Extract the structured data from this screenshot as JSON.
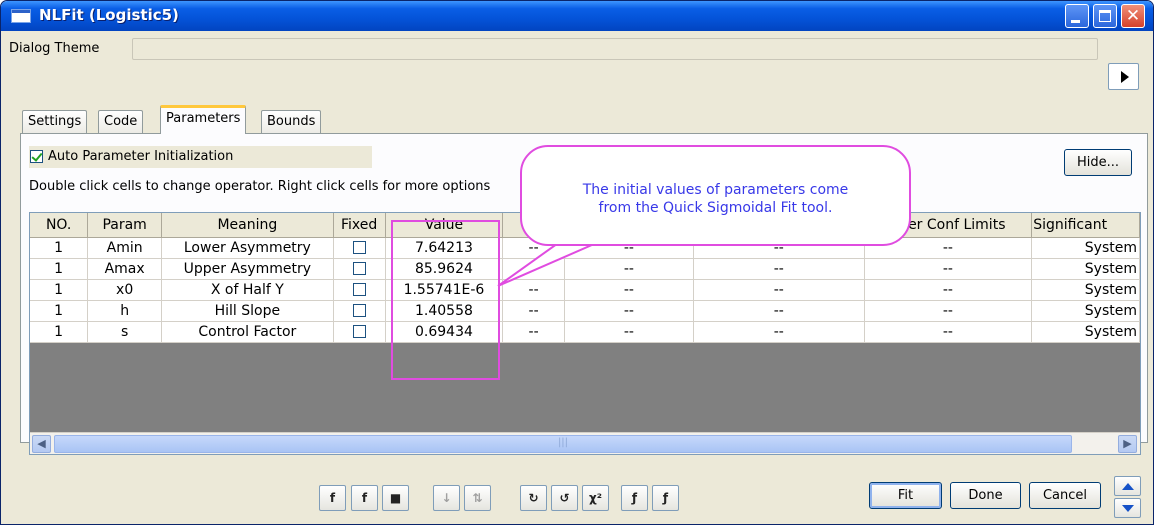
{
  "window": {
    "title": "NLFit (Logistic5)"
  },
  "theme": {
    "label": "Dialog Theme",
    "value": ""
  },
  "tabs": [
    {
      "label": "Settings"
    },
    {
      "label": "Code"
    },
    {
      "label": "Parameters"
    },
    {
      "label": "Bounds"
    }
  ],
  "parameters_tab": {
    "auto_init_label": "Auto Parameter Initialization",
    "auto_init_checked": true,
    "hint": "Double click cells to change operator. Right click cells for more options",
    "hide_label": "Hide..."
  },
  "table": {
    "headers": [
      "NO.",
      "Param",
      "Meaning",
      "Fixed",
      "Value",
      "",
      "",
      "",
      "pper Conf Limits",
      "Significant"
    ],
    "rows": [
      {
        "no": "1",
        "param": "Amin",
        "meaning": "Lower Asymmetry",
        "fixed": false,
        "value": "7.64213",
        "c6": "--",
        "c7": "--",
        "c8": "--",
        "c9": "--",
        "sig": "System"
      },
      {
        "no": "1",
        "param": "Amax",
        "meaning": "Upper Asymmetry",
        "fixed": false,
        "value": "85.9624",
        "c6": "--",
        "c7": "--",
        "c8": "--",
        "c9": "--",
        "sig": "System"
      },
      {
        "no": "1",
        "param": "x0",
        "meaning": "X of Half Y",
        "fixed": false,
        "value": "1.55741E-6",
        "c6": "--",
        "c7": "--",
        "c8": "--",
        "c9": "--",
        "sig": "System"
      },
      {
        "no": "1",
        "param": "h",
        "meaning": "Hill Slope",
        "fixed": false,
        "value": "1.40558",
        "c6": "--",
        "c7": "--",
        "c8": "--",
        "c9": "--",
        "sig": "System"
      },
      {
        "no": "1",
        "param": "s",
        "meaning": "Control Factor",
        "fixed": false,
        "value": "0.69434",
        "c6": "--",
        "c7": "--",
        "c8": "--",
        "c9": "--",
        "sig": "System"
      }
    ]
  },
  "callout": {
    "line1": "The initial values of parameters come",
    "line2": "from the Quick Sigmoidal Fit tool."
  },
  "toolbar": {
    "icons": [
      {
        "name": "fx-edit-icon",
        "glyph": "f",
        "dim": false
      },
      {
        "name": "function-icon",
        "glyph": "f",
        "dim": false
      },
      {
        "name": "save-icon",
        "glyph": "■",
        "dim": false
      },
      {
        "name": "sort-icon",
        "glyph": "↓",
        "dim": true
      },
      {
        "name": "swap-icon",
        "glyph": "⇅",
        "dim": true
      },
      {
        "name": "iterate-p-icon",
        "glyph": "↻",
        "dim": false
      },
      {
        "name": "iterate-s-icon",
        "glyph": "↺",
        "dim": false
      },
      {
        "name": "chi-square-icon",
        "glyph": "χ²",
        "dim": false
      },
      {
        "name": "one-iteration-icon",
        "glyph": "ƒ",
        "dim": false
      },
      {
        "name": "fit-until-converge-icon",
        "glyph": "ƒ",
        "dim": false
      }
    ],
    "fit_label": "Fit",
    "done_label": "Done",
    "cancel_label": "Cancel"
  },
  "colors": {
    "titlebar": "#0453d8",
    "callout_border": "#e04ce0",
    "callout_text": "#3838e8"
  }
}
